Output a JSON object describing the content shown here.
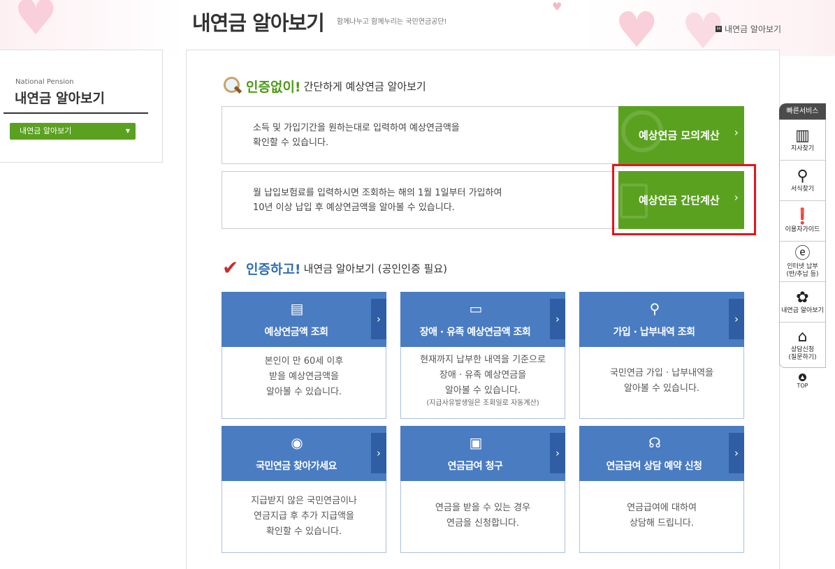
{
  "header": {
    "page_title": "내연금 알아보기",
    "page_subtitle": "함께나누고 함께누리는 국민연금공단!",
    "breadcrumb_icon": "home-icon",
    "breadcrumb_label": "내연금 알아보기"
  },
  "sidebar": {
    "title_en": "National Pension",
    "title_ko": "내연금 알아보기",
    "select_label": "내연금 알아보기"
  },
  "section1": {
    "emphasis": "인증없이!",
    "rest": "간단하게 예상연금 알아보기",
    "rows": [
      {
        "desc_line1": "소득 및 가입기간을 원하는대로 입력하여 예상연금액을",
        "desc_line2": "확인할 수 있습니다.",
        "button": "예상연금 모의계산"
      },
      {
        "desc_line1": "월 납입보험료를 입력하시면 조회하는 해의 1월 1일부터 가입하여",
        "desc_line2": "10년 이상 납입 후 예상연금액을 알아볼 수 있습니다.",
        "button": "예상연금 간단계산"
      }
    ]
  },
  "section2": {
    "emphasis": "인증하고!",
    "rest": "내연금 알아보기 (공인인증 필요)",
    "cards": [
      {
        "title": "예상연금액 조회",
        "l1": "본인이 만 60세 이후",
        "l2": "받을 예상연금액을",
        "l3": "알아볼 수 있습니다.",
        "note": ""
      },
      {
        "title": "장애 · 유족 예상연금액 조회",
        "l1": "현재까지 납부한 내역을 기준으로",
        "l2": "장애 · 유족 예상연금을",
        "l3": "알아볼 수 있습니다.",
        "note": "(지급사유발생일은 조회일로 자동계산)"
      },
      {
        "title": "가입 · 납부내역 조회",
        "l1": "국민연금 가입 · 납부내역을",
        "l2": "알아볼 수 있습니다.",
        "l3": "",
        "note": ""
      },
      {
        "title": "국민연금 찾아가세요",
        "l1": "지급받지 않은 국민연금이나",
        "l2": "연금지급 후 추가 지급액을",
        "l3": "확인할 수 있습니다.",
        "note": ""
      },
      {
        "title": "연금급여 청구",
        "l1": "연금을 받을 수 있는 경우",
        "l2": "연금을 신청합니다.",
        "l3": "",
        "note": ""
      },
      {
        "title": "연금급여 상담 예약 신청",
        "l1": "연금급여에 대하여",
        "l2": "상담해 드립니다.",
        "l3": "",
        "note": ""
      }
    ]
  },
  "quick": {
    "header": "빠른서비스",
    "items": [
      {
        "label": "지사찾기",
        "label2": "",
        "icon": "building-icon"
      },
      {
        "label": "서식찾기",
        "label2": "",
        "icon": "document-search-icon"
      },
      {
        "label": "이용자가이드",
        "label2": "",
        "icon": "guide-icon"
      },
      {
        "label": "인터넷 납부",
        "label2": "(반/추납 등)",
        "icon": "internet-icon"
      },
      {
        "label": "내연금 알아보기",
        "label2": "",
        "icon": "clover-icon"
      },
      {
        "label": "상담신청",
        "label2": "(질문하기)",
        "icon": "mouse-icon"
      }
    ],
    "top": "TOP"
  },
  "colors": {
    "green": "#5aa120",
    "blue": "#4a7cc2",
    "highlight": "#e5141c"
  }
}
